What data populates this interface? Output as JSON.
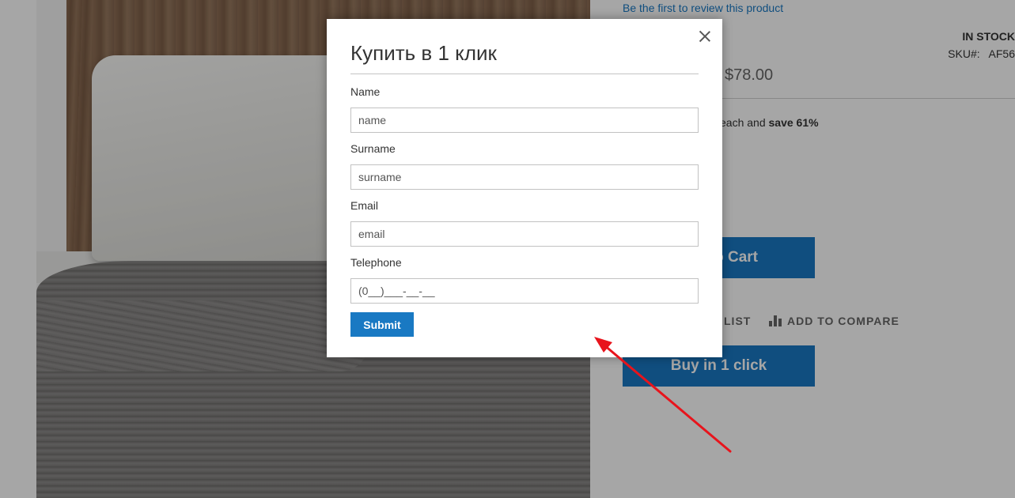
{
  "product": {
    "review_link": "Be the first to review this product",
    "stock": "IN STOCK",
    "sku_label": "SKU#:",
    "sku_value": "AF56",
    "price": "$78.00",
    "tier_prefix": "each and",
    "tier_save": "save 61%",
    "add_to_cart_label": "o Cart",
    "wishlist_label": "LIST",
    "compare_label": "ADD TO COMPARE",
    "buy_one_click_label": "Buy in 1 click"
  },
  "modal": {
    "title": "Купить в 1 клик",
    "fields": [
      {
        "label": "Name",
        "placeholder": "name"
      },
      {
        "label": "Surname",
        "placeholder": "surname"
      },
      {
        "label": "Email",
        "placeholder": "email"
      },
      {
        "label": "Telephone",
        "placeholder": "(0__)___-__-__"
      }
    ],
    "submit_label": "Submit"
  },
  "colors": {
    "primary_button": "#1979c3",
    "link": "#1979c3",
    "annotation_arrow": "#e8141c"
  },
  "icons": {
    "close": "close-icon",
    "compare": "bar-chart-icon"
  }
}
